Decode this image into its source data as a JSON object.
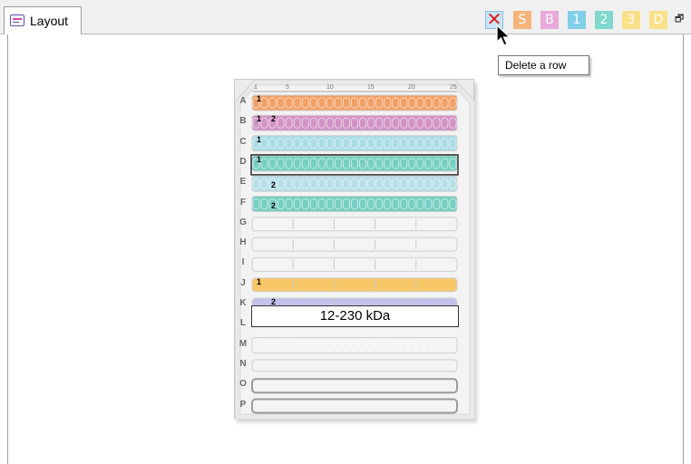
{
  "tab": {
    "label": "Layout",
    "icon": "layout-icon"
  },
  "toolbar": {
    "delete_icon": "✕",
    "buttons": [
      {
        "label": "S",
        "color": "#f6b47a"
      },
      {
        "label": "B",
        "color": "#e9a9d9"
      },
      {
        "label": "1",
        "color": "#83cfe8"
      },
      {
        "label": "2",
        "color": "#7fd8cb"
      },
      {
        "label": "3",
        "color": "#fbe08a"
      },
      {
        "label": "D",
        "color": "#fbe08a"
      }
    ],
    "restore_icon": "🗗"
  },
  "tooltip": {
    "text": "Delete a row"
  },
  "gel": {
    "ticks": [
      "1",
      "5",
      "10",
      "15",
      "20",
      "25"
    ],
    "rows": [
      {
        "letter": "A",
        "style": "wells",
        "color": "#f2a066",
        "nums": [
          "1"
        ]
      },
      {
        "letter": "B",
        "style": "wells",
        "color": "#d393c6",
        "nums": [
          "1",
          "2"
        ]
      },
      {
        "letter": "C",
        "style": "wells",
        "color": "#a9dce6",
        "nums": [
          "1"
        ]
      },
      {
        "letter": "D",
        "style": "wells",
        "color": "#77cfc3",
        "nums": [
          "1"
        ],
        "selected": true
      },
      {
        "letter": "E",
        "style": "wells",
        "color": "#b6dfe8",
        "nums": [
          "2"
        ]
      },
      {
        "letter": "F",
        "style": "wells",
        "color": "#77cfc3",
        "nums": [
          "2"
        ]
      },
      {
        "letter": "G",
        "style": "segments5",
        "color": "#f4f4f4",
        "nums": []
      },
      {
        "letter": "H",
        "style": "segments5",
        "color": "#f4f4f4",
        "nums": []
      },
      {
        "letter": "I",
        "style": "segments5",
        "color": "#f4f4f4",
        "nums": []
      },
      {
        "letter": "J",
        "style": "segments5",
        "color": "#f8c868",
        "nums": [
          "1"
        ]
      },
      {
        "letter": "K",
        "style": "segments5",
        "color": "#c2c2ec",
        "nums": [
          "2"
        ]
      },
      {
        "letter": "L",
        "style": "label",
        "color": "#ffffff",
        "nums": []
      },
      {
        "letter": "M",
        "style": "wells",
        "color": "#f4f4f4",
        "nums": []
      },
      {
        "letter": "N",
        "style": "plain",
        "color": "#f4f4f4",
        "nums": []
      },
      {
        "letter": "O",
        "style": "thick",
        "color": "#f4f4f4",
        "nums": []
      },
      {
        "letter": "P",
        "style": "thick",
        "color": "#f4f4f4",
        "nums": []
      }
    ],
    "band_label": "12-230 kDa"
  }
}
